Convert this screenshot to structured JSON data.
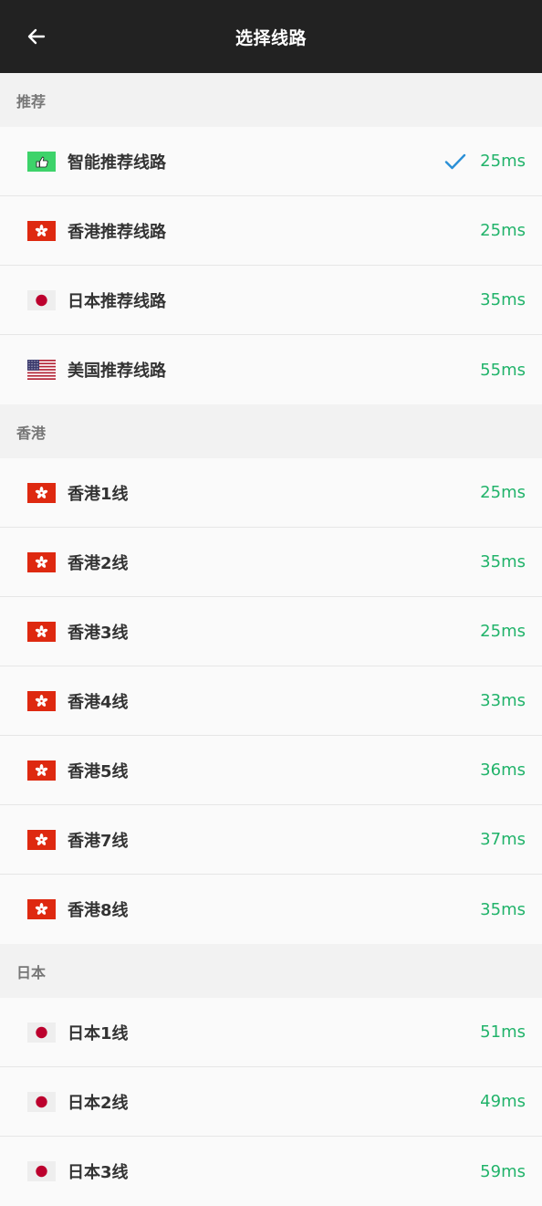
{
  "header": {
    "title": "选择线路",
    "back_icon": "arrow-left-icon"
  },
  "colors": {
    "appbar": "#222222",
    "ping": "#21b36a",
    "check": "#2a8fd6",
    "section_bg": "#f2f2f2"
  },
  "sections": [
    {
      "title": "推荐",
      "items": [
        {
          "label": "智能推荐线路",
          "ping": "25ms",
          "flag": "smart-icon",
          "selected": true
        },
        {
          "label": "香港推荐线路",
          "ping": "25ms",
          "flag": "hk-flag-icon",
          "selected": false
        },
        {
          "label": "日本推荐线路",
          "ping": "35ms",
          "flag": "jp-flag-icon",
          "selected": false
        },
        {
          "label": "美国推荐线路",
          "ping": "55ms",
          "flag": "us-flag-icon",
          "selected": false
        }
      ]
    },
    {
      "title": "香港",
      "items": [
        {
          "label": "香港1线",
          "ping": "25ms",
          "flag": "hk-flag-icon",
          "selected": false
        },
        {
          "label": "香港2线",
          "ping": "35ms",
          "flag": "hk-flag-icon",
          "selected": false
        },
        {
          "label": "香港3线",
          "ping": "25ms",
          "flag": "hk-flag-icon",
          "selected": false
        },
        {
          "label": "香港4线",
          "ping": "33ms",
          "flag": "hk-flag-icon",
          "selected": false
        },
        {
          "label": "香港5线",
          "ping": "36ms",
          "flag": "hk-flag-icon",
          "selected": false
        },
        {
          "label": "香港7线",
          "ping": "37ms",
          "flag": "hk-flag-icon",
          "selected": false
        },
        {
          "label": "香港8线",
          "ping": "35ms",
          "flag": "hk-flag-icon",
          "selected": false
        }
      ]
    },
    {
      "title": "日本",
      "items": [
        {
          "label": "日本1线",
          "ping": "51ms",
          "flag": "jp-flag-icon",
          "selected": false
        },
        {
          "label": "日本2线",
          "ping": "49ms",
          "flag": "jp-flag-icon",
          "selected": false
        },
        {
          "label": "日本3线",
          "ping": "59ms",
          "flag": "jp-flag-icon",
          "selected": false
        }
      ]
    }
  ]
}
